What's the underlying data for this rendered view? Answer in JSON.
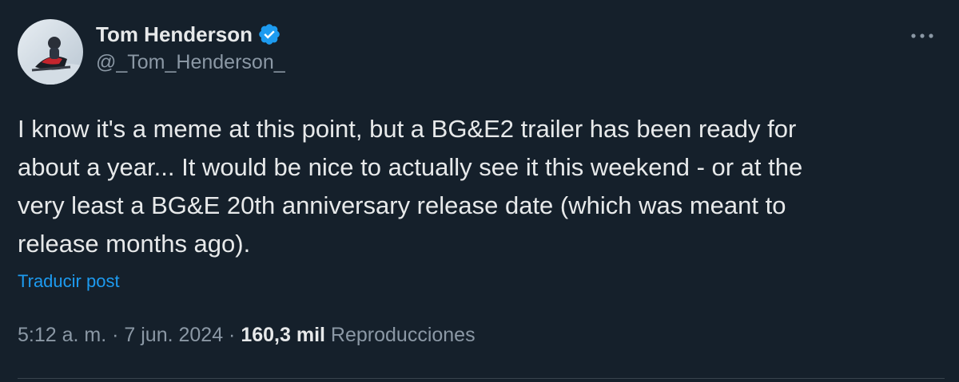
{
  "author": {
    "display_name": "Tom Henderson",
    "handle": "@_Tom_Henderson_",
    "verified": true
  },
  "post": {
    "text": "I know it's a meme at this point, but a BG&E2 trailer has been ready for\nabout a year... It would be nice to actually see it this weekend - or at the\nvery least a BG&E 20th anniversary release date (which was meant to\nrelease months ago).",
    "translate_label": "Traducir post"
  },
  "meta": {
    "time": "5:12 a. m.",
    "separator": " · ",
    "date": "7 jun. 2024",
    "views_count": "160,3 mil",
    "views_label": "Reproducciones"
  },
  "icons": {
    "verified": "verified-badge-icon",
    "more": "more-options-icon"
  },
  "colors": {
    "background": "#15202b",
    "text_primary": "#e7e9ea",
    "text_secondary": "#8b98a5",
    "accent": "#1d9bf0",
    "divider": "#38444d"
  }
}
